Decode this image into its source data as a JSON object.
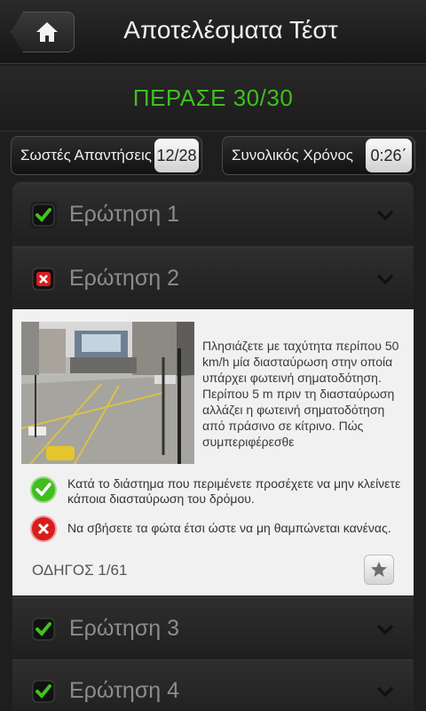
{
  "header": {
    "title": "Αποτελέσματα Τέστ",
    "home_icon": "home-icon"
  },
  "result": {
    "pass_text": "ΠΕΡΑΣΕ 30/30",
    "pass_color": "#3fbf1f"
  },
  "stats": {
    "correct_label": "Σωστές Απαντήσεις",
    "correct_value": "12/28",
    "time_label": "Συνολικός Χρόνος",
    "time_value": "0:26΄"
  },
  "questions": [
    {
      "label": "Ερώτηση 1",
      "status": "correct"
    },
    {
      "label": "Ερώτηση 2",
      "status": "wrong"
    },
    {
      "label": "Ερώτηση 3",
      "status": "correct"
    },
    {
      "label": "Ερώτηση 4",
      "status": "correct"
    }
  ],
  "expanded": {
    "question_text": "Πλησιάζετε με ταχύτητα περίπου 50 km/h μία διασταύρωση στην οποία υπάρχει φωτεινή σηματοδότηση. Περίπου 5 m πριν τη διασταύρωση αλλάζει η φωτεινή σηματοδότηση από πράσινο σε κίτρινο. Πώς συμπεριφέρεσθε",
    "answers": [
      {
        "text": "Κατά το διάστημα που περιμένετε προσέχετε να μην κλείνετε κάποια διασταύρωση του δρόμου.",
        "status": "correct"
      },
      {
        "text": "Να σβήσετε τα φώτα έτσι ώστε να μη θαμπώνεται κανένας.",
        "status": "wrong"
      }
    ],
    "guide_text": "ΟΔΗΓΟΣ 1/61",
    "star_icon": "star-icon"
  }
}
